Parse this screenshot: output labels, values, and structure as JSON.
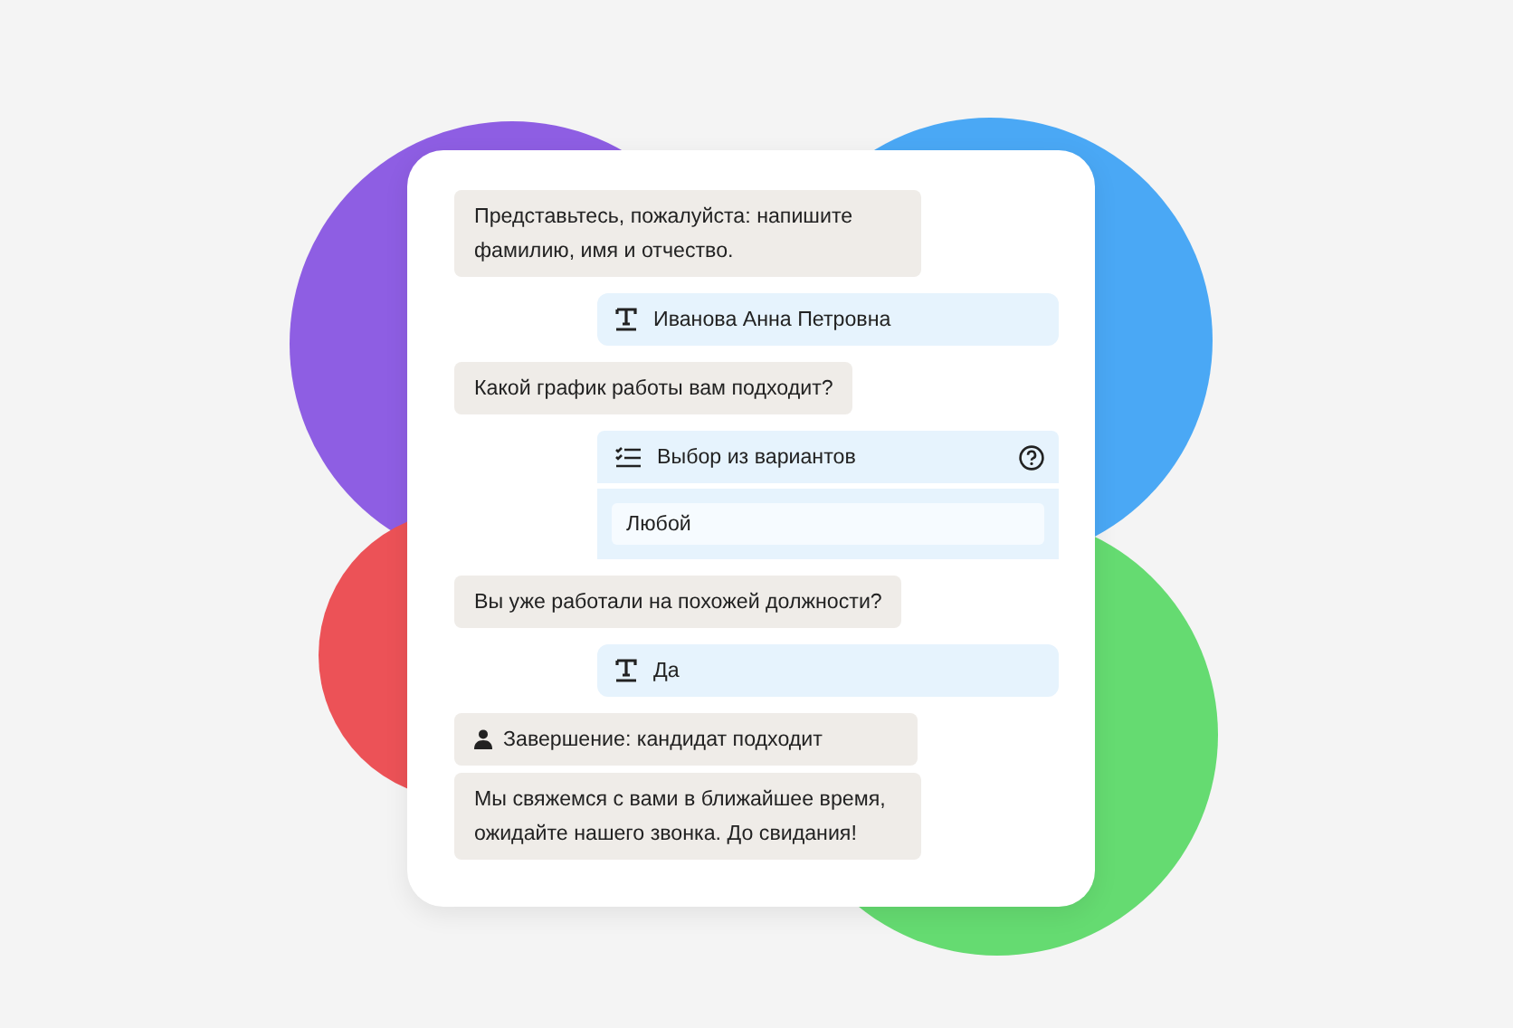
{
  "messages": [
    {
      "kind": "bot",
      "text": "Представьтесь, пожалуйста: напишите фамилию, имя и отчество."
    },
    {
      "kind": "answer",
      "text": "Иванова Анна Петровна"
    },
    {
      "kind": "bot",
      "text": "Какой график работы вам подходит?"
    },
    {
      "kind": "choice",
      "title": "Выбор из вариантов",
      "option": "Любой"
    },
    {
      "kind": "bot",
      "text": "Вы уже работали на похожей должности?"
    },
    {
      "kind": "answer",
      "text": "Да"
    },
    {
      "kind": "end",
      "title": "Завершение: кандидат подходит",
      "text": "Мы свяжемся с вами в ближайшее время, ожидайте нашего звонка. До свидания!"
    }
  ]
}
